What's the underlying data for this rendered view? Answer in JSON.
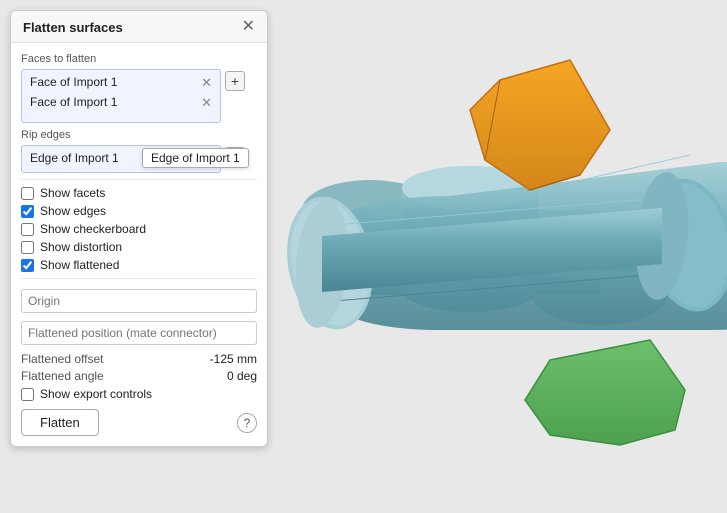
{
  "panel": {
    "title": "Flatten surfaces",
    "faces_to_flatten_label": "Faces to flatten",
    "face_items": [
      {
        "label": "Face of Import 1"
      },
      {
        "label": "Face of Import 1"
      }
    ],
    "rip_edges_label": "Rip edges",
    "edge_items": [
      {
        "label": "Edge of Import 1"
      }
    ],
    "tooltip_text": "Edge of Import 1",
    "checkboxes": [
      {
        "id": "cb-facets",
        "label": "Show facets",
        "checked": false
      },
      {
        "id": "cb-edges",
        "label": "Show edges",
        "checked": true
      },
      {
        "id": "cb-checkerboard",
        "label": "Show checkerboard",
        "checked": false
      },
      {
        "id": "cb-distortion",
        "label": "Show distortion",
        "checked": false
      },
      {
        "id": "cb-flattened",
        "label": "Show flattened",
        "checked": true
      }
    ],
    "origin_placeholder": "Origin",
    "flatten_position_placeholder": "Flattened position (mate connector)",
    "flattened_offset_label": "Flattened offset",
    "flattened_offset_value": "-125 mm",
    "flattened_angle_label": "Flattened angle",
    "flattened_angle_value": "0 deg",
    "show_export_controls_label": "Show export controls",
    "flatten_button_label": "Flatten",
    "help_icon_label": "?"
  }
}
